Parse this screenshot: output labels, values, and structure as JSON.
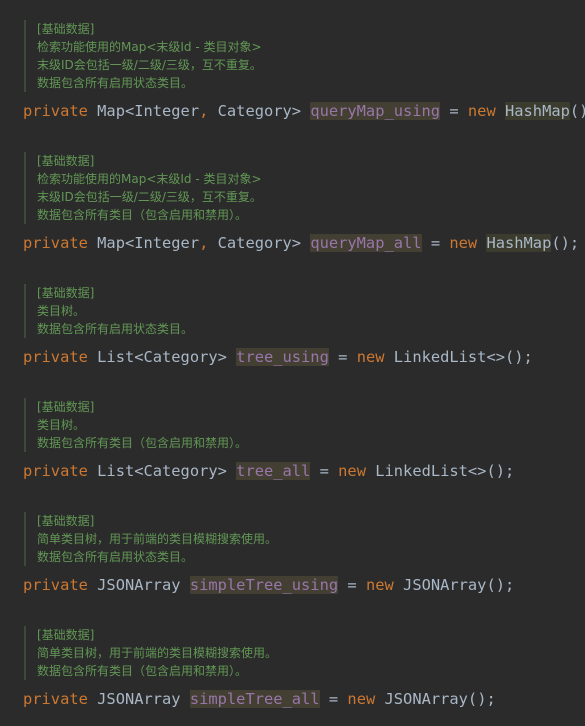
{
  "blocks": [
    {
      "doc": [
        "[基础数据]",
        "检索功能使用的Map<末级Id - 类目对象>",
        "末级ID会包括一级/二级/三级，互不重复。",
        "数据包含所有启用状态类目。"
      ],
      "modifier": "private",
      "type_pre": "Map<Integer",
      "comma": ",",
      "type_post": " Category>",
      "field": "queryMap_using",
      "assign": "=",
      "new_kw": "new",
      "ctor": "HashMap",
      "tail": "();"
    },
    {
      "doc": [
        "[基础数据]",
        "检索功能使用的Map<末级Id - 类目对象>",
        "末级ID会包括一级/二级/三级，互不重复。",
        "数据包含所有类目（包含启用和禁用）。"
      ],
      "modifier": "private",
      "type_pre": "Map<Integer",
      "comma": ",",
      "type_post": " Category>",
      "field": "queryMap_all",
      "assign": "=",
      "new_kw": "new",
      "ctor": "HashMap",
      "tail": "();"
    },
    {
      "doc": [
        "[基础数据]",
        "类目树。",
        "数据包含所有启用状态类目。"
      ],
      "modifier": "private",
      "type_pre": "List<Category>",
      "comma": "",
      "type_post": "",
      "field": "tree_using",
      "assign": "=",
      "new_kw": "new",
      "ctor": "LinkedList<>",
      "tail": "();"
    },
    {
      "doc": [
        "[基础数据]",
        "类目树。",
        "数据包含所有类目（包含启用和禁用）。"
      ],
      "modifier": "private",
      "type_pre": "List<Category>",
      "comma": "",
      "type_post": "",
      "field": "tree_all",
      "assign": "=",
      "new_kw": "new",
      "ctor": "LinkedList<>",
      "tail": "();"
    },
    {
      "doc": [
        "[基础数据]",
        "简单类目树，用于前端的类目模糊搜索使用。",
        "数据包含所有启用状态类目。"
      ],
      "modifier": "private",
      "type_pre": "JSONArray",
      "comma": "",
      "type_post": "",
      "field": "simpleTree_using",
      "assign": "=",
      "new_kw": "new",
      "ctor": "JSONArray",
      "tail": "();"
    },
    {
      "doc": [
        "[基础数据]",
        "简单类目树，用于前端的类目模糊搜索使用。",
        "数据包含所有类目（包含启用和禁用）。"
      ],
      "modifier": "private",
      "type_pre": "JSONArray",
      "comma": "",
      "type_post": "",
      "field": "simpleTree_all",
      "assign": "=",
      "new_kw": "new",
      "ctor": "JSONArray",
      "tail": "();"
    }
  ]
}
